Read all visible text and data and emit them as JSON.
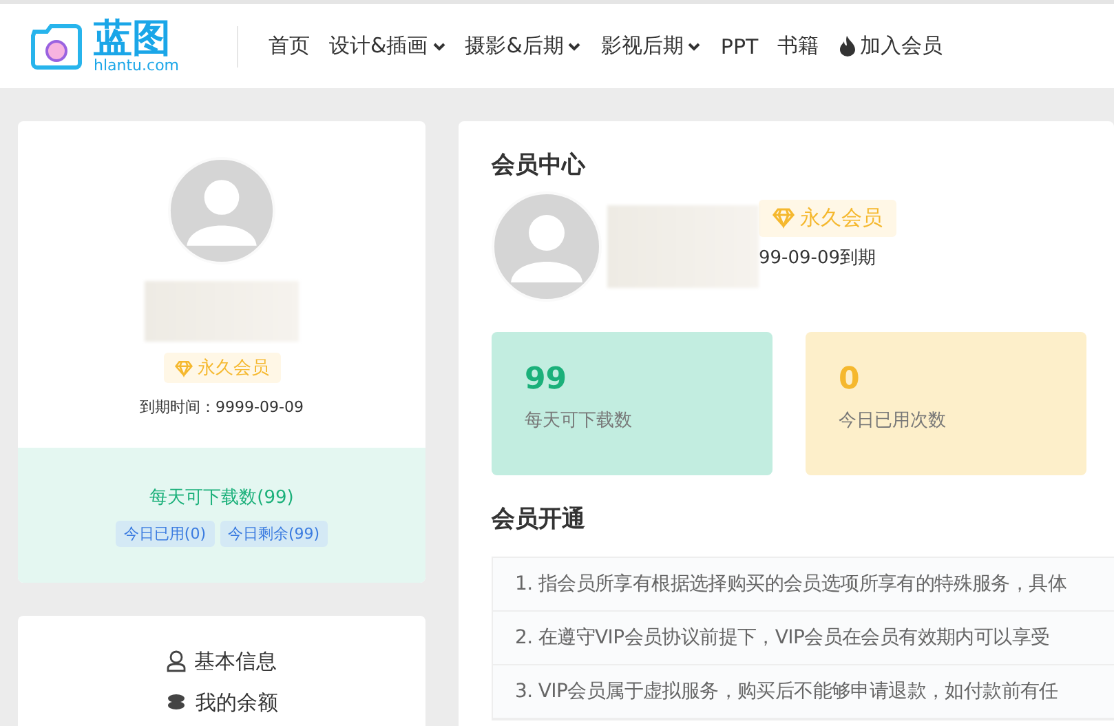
{
  "logo": {
    "name": "蓝图",
    "domain": "hlantu.com"
  },
  "nav": [
    {
      "label": "首页",
      "dropdown": false
    },
    {
      "label": "设计&插画",
      "dropdown": true
    },
    {
      "label": "摄影&后期",
      "dropdown": true
    },
    {
      "label": "影视后期",
      "dropdown": true
    },
    {
      "label": "PPT",
      "dropdown": false
    },
    {
      "label": "书籍",
      "dropdown": false
    },
    {
      "label": "加入会员",
      "dropdown": false,
      "kind": "fire"
    }
  ],
  "profile": {
    "badge": "永久会员",
    "expiry": "到期时间：9999-09-09",
    "quota": {
      "title": "每天可下载数(99)",
      "tags": [
        "今日已用(0)",
        "今日剩余(99)"
      ]
    }
  },
  "menu": [
    {
      "label": "基本信息",
      "kind": "user"
    },
    {
      "label": "我的余额",
      "kind": "coins"
    }
  ],
  "member_center": {
    "title": "会员中心",
    "badge": "永久会员",
    "expiry": "99-09-09到期",
    "stats": [
      {
        "value": "99",
        "label": "每天可下载数",
        "kind": "green"
      },
      {
        "value": "0",
        "label": "今日已用次数",
        "kind": "yellow"
      }
    ]
  },
  "open": {
    "title": "会员开通",
    "items": [
      "1. 指会员所享有根据选择购买的会员选项所享有的特殊服务，具体",
      "2. 在遵守VIP会员协议前提下，VIP会员在会员有效期内可以享受",
      "3. VIP会员属于虚拟服务，购买后不能够申请退款，如付款前有任"
    ]
  }
}
